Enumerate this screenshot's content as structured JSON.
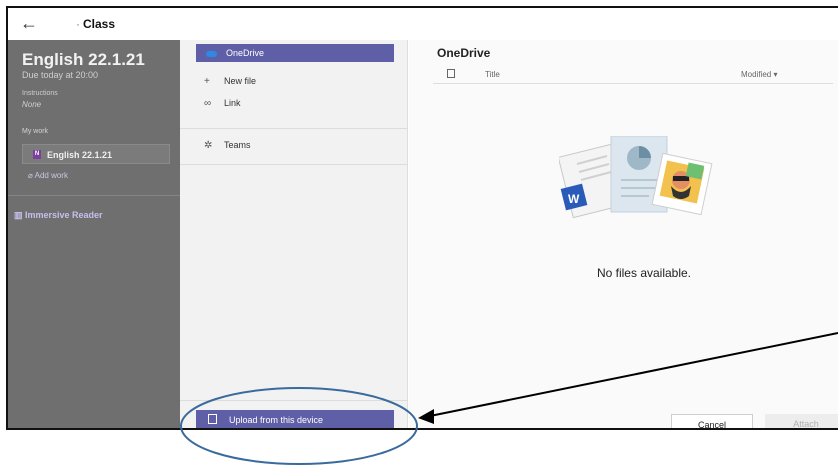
{
  "header": {
    "back_glyph": "←",
    "breadcrumb_separator": "·",
    "title": "Class"
  },
  "assignment": {
    "title": "English 22.1.21",
    "due": "Due today at 20:00",
    "instructions_label": "Instructions",
    "instructions_value": "None",
    "my_work_label": "My work",
    "work_item": "English 22.1.21",
    "add_work": "Add work",
    "immersive_reader": "Immersive Reader"
  },
  "sources": {
    "items": [
      {
        "label": "OneDrive",
        "selected": true,
        "icon": "cloud-icon"
      },
      {
        "label": "New file",
        "icon": "plus-icon"
      },
      {
        "label": "Link",
        "icon": "link-icon"
      },
      {
        "label": "Teams",
        "icon": "teams-icon"
      }
    ],
    "upload_label": "Upload from this device"
  },
  "files": {
    "heading": "OneDrive",
    "columns": {
      "title": "Title",
      "modified": "Modified ▾"
    },
    "empty_message": "No files available."
  },
  "actions": {
    "cancel": "Cancel",
    "attach": "Attach"
  },
  "colors": {
    "accent": "#5f5fa8",
    "overlay_panel": "#6f6f6f",
    "annotation": "#3a6b9c"
  }
}
